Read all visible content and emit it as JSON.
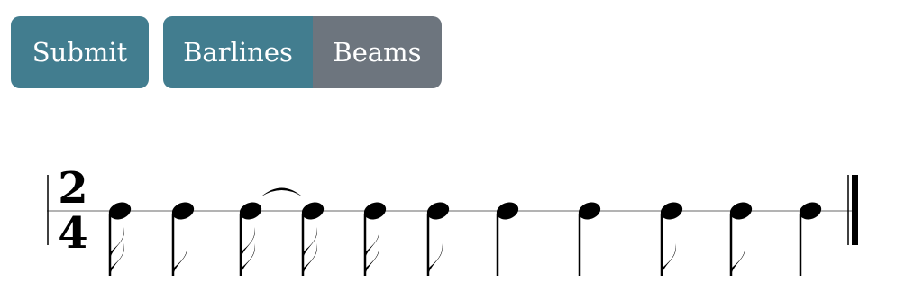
{
  "toolbar": {
    "submit_label": "Submit",
    "toggle_group": [
      {
        "label": "Barlines",
        "active": true
      },
      {
        "label": "Beams",
        "active": false
      }
    ]
  },
  "score": {
    "time_signature": {
      "top": "2",
      "bottom": "4"
    },
    "notes": [
      {
        "type": "sixteenth",
        "tie_to_next": false
      },
      {
        "type": "eighth",
        "tie_to_next": false
      },
      {
        "type": "sixteenth",
        "tie_to_next": true
      },
      {
        "type": "sixteenth",
        "tie_to_next": false
      },
      {
        "type": "sixteenth",
        "tie_to_next": false
      },
      {
        "type": "eighth",
        "tie_to_next": false
      },
      {
        "type": "quarter",
        "tie_to_next": false
      },
      {
        "type": "quarter",
        "tie_to_next": false
      },
      {
        "type": "eighth",
        "tie_to_next": false
      },
      {
        "type": "eighth",
        "tie_to_next": false
      },
      {
        "type": "quarter",
        "tie_to_next": false
      }
    ],
    "end_barline": "final"
  },
  "colors": {
    "primary": "#427d8f",
    "secondary": "#6d757e",
    "staff_line": "#9a9a9a",
    "ink": "#000000"
  }
}
